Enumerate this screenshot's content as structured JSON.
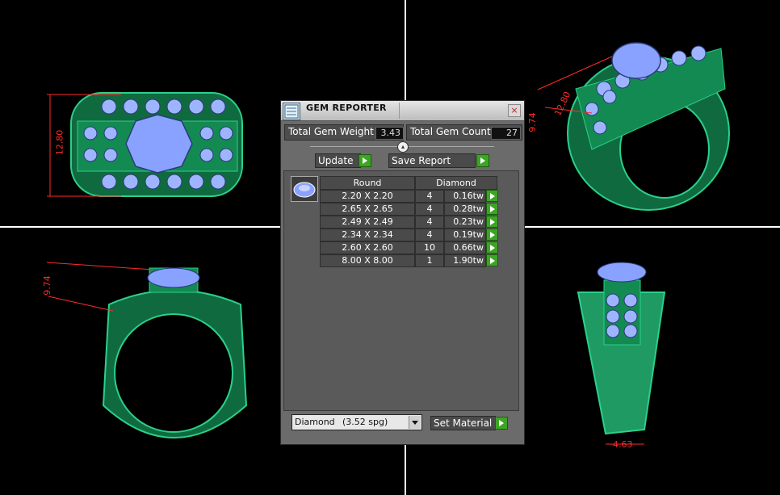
{
  "viewports": {
    "top_left_dimension": "12.80",
    "top_right_dimension_1": "12.80",
    "top_right_dimension_2": "9.74",
    "bottom_left_dimension": "9.74",
    "bottom_right_dimension": "4.63"
  },
  "dialog": {
    "title": "GEM REPORTER",
    "close_label": "×",
    "total_gem_weight_label": "Total Gem Weight",
    "total_gem_weight_value": "3.43",
    "total_gem_count_label": "Total Gem Count",
    "total_gem_count_value": "27",
    "update_label": "Update",
    "save_report_label": "Save Report",
    "table": {
      "headers": [
        "Round",
        "Diamond"
      ],
      "rows": [
        {
          "size": "2.20 X 2.20",
          "count": "4",
          "weight": "0.16tw"
        },
        {
          "size": "2.65 X 2.65",
          "count": "4",
          "weight": "0.28tw"
        },
        {
          "size": "2.49 X 2.49",
          "count": "4",
          "weight": "0.23tw"
        },
        {
          "size": "2.34 X 2.34",
          "count": "4",
          "weight": "0.19tw"
        },
        {
          "size": "2.60 X 2.60",
          "count": "10",
          "weight": "0.66tw"
        },
        {
          "size": "8.00 X 8.00",
          "count": "1",
          "weight": "1.90tw"
        }
      ]
    },
    "material_select": {
      "name": "Diamond",
      "density": "(3.52 spg)"
    },
    "set_material_label": "Set Material"
  },
  "colors": {
    "ring_green": "#1f9a63",
    "gem_blue": "#8aa2ff",
    "dimension_red": "#ff2a2a",
    "button_green": "#3da524"
  }
}
